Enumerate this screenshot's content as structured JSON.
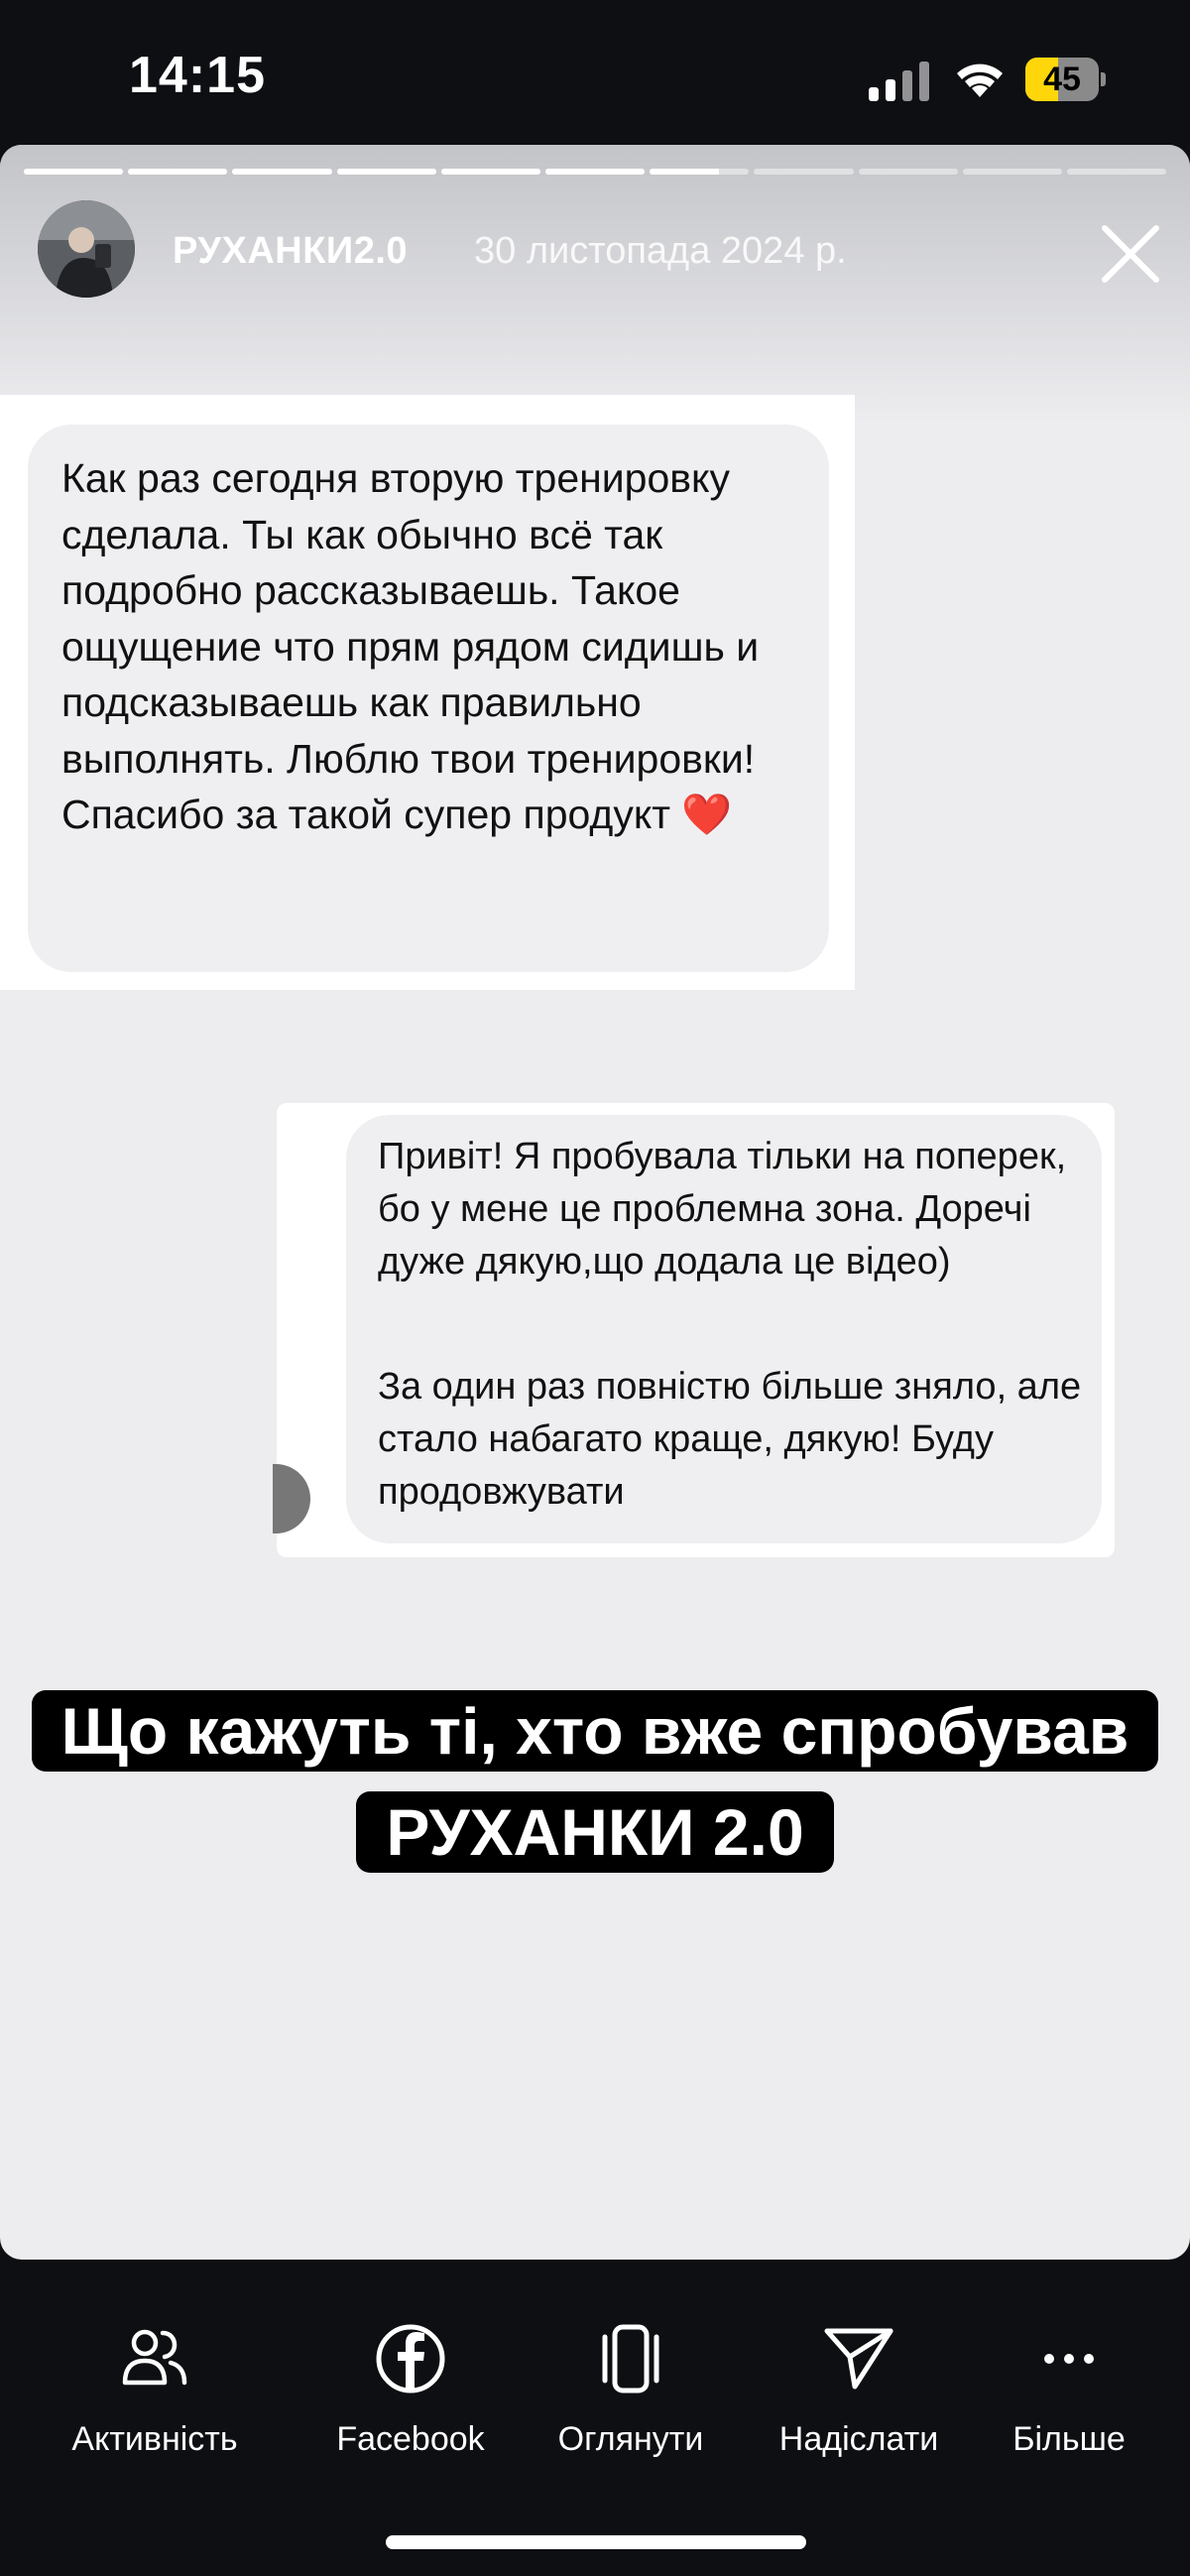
{
  "status_bar": {
    "time": "14:15",
    "battery_level": "45",
    "battery_percent": 45,
    "battery_color": "#ffd60a",
    "signal_icon": "cellular-signal-icon",
    "wifi_icon": "wifi-icon"
  },
  "story": {
    "progress": {
      "segments": 11,
      "completed": 6,
      "current_fraction": 0.7
    },
    "username": "РУХАНКИ2.0",
    "date": "30 листопада 2024 р.",
    "close_icon": "close-icon",
    "message_1": "Как раз сегодня вторую тренировку сделала. Ты как обычно всё так подробно рассказываешь. Такое ощущение что прям рядом сидишь и подсказываешь как правильно выполнять. Люблю твои тренировки! Спасибо за такой супер продукт ❤️",
    "message_2_line_1": "Привіт! Я пробувала тільки на поперек, бо у мене це проблемна зона. Доречі дуже дякую,що додала це відео)",
    "message_2_line_2": "За один раз повністю більше зняло, але стало набагато краще, дякую! Буду продовжувати",
    "caption": "Що кажуть ті, хто вже спробував РУХАНКИ 2.0"
  },
  "actions": [
    {
      "label": "Активність",
      "icon": "activity-people-icon"
    },
    {
      "label": "Facebook",
      "icon": "facebook-icon"
    },
    {
      "label": "Оглянути",
      "icon": "browse-cards-icon"
    },
    {
      "label": "Надіслати",
      "icon": "send-icon"
    },
    {
      "label": "Більше",
      "icon": "more-icon"
    }
  ]
}
